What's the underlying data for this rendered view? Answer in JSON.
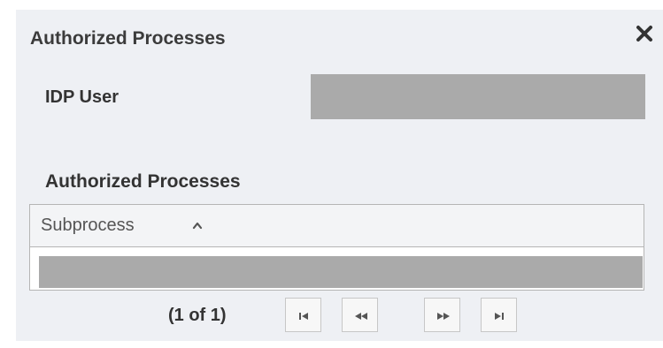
{
  "dialog": {
    "title": "Authorized Processes",
    "close_icon": "close-icon"
  },
  "form": {
    "idp_user_label": "IDP User",
    "idp_user_value": ""
  },
  "section": {
    "title": "Authorized Processes"
  },
  "grid": {
    "columns": [
      {
        "label": "Subprocess",
        "sort": "ascending"
      }
    ],
    "rows": [
      {
        "subprocess": ""
      }
    ]
  },
  "pager": {
    "text": "(1 of 1)",
    "current_page": 1,
    "total_pages": 1,
    "buttons": [
      "first-page-icon",
      "previous-page-icon",
      "next-page-icon",
      "last-page-icon"
    ]
  },
  "colors": {
    "dialog_background": "#eef0f4",
    "redacted_fill": "#aaaaaa",
    "text": "#333333"
  }
}
